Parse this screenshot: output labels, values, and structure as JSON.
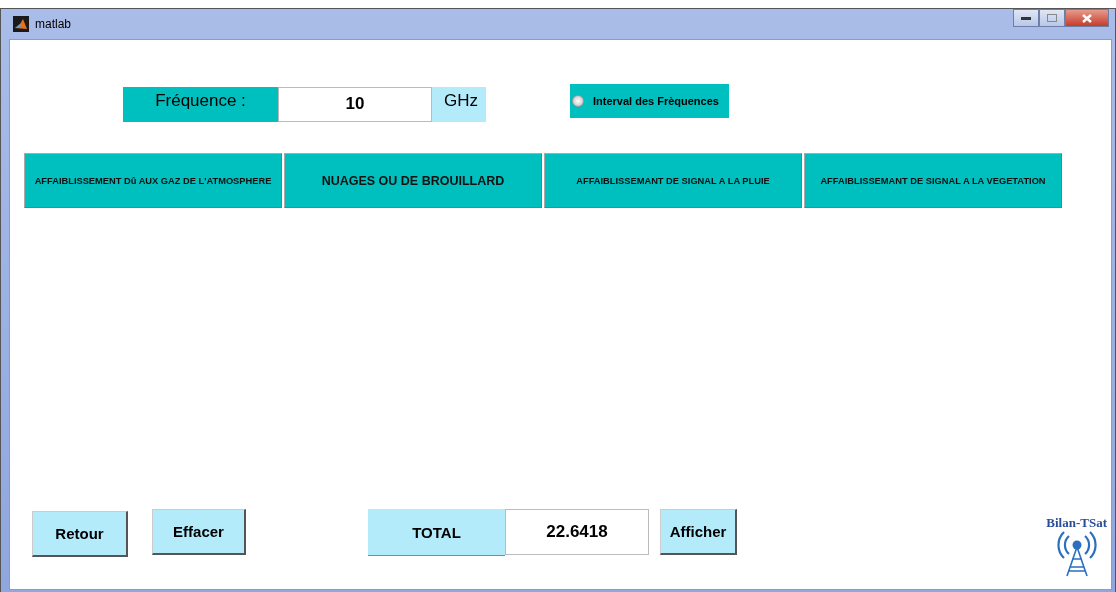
{
  "window": {
    "title": "matlab"
  },
  "frequency": {
    "label": "Fréquence :",
    "value": "10",
    "unit": "GHz"
  },
  "interval_option": {
    "label": "Interval des Frèquences",
    "checked": false
  },
  "categories": [
    {
      "label": "AFFAIBLISSEMENT Dû AUX GAZ  DE L'ATMOSPHERE",
      "kind": "small"
    },
    {
      "label": "NUAGES OU DE BROUILLARD",
      "kind": "large"
    },
    {
      "label": "AFFAIBLISSEMANT DE SIGNAL A LA PLUIE",
      "kind": "small"
    },
    {
      "label": "AFFAIBLISSEMANT DE SIGNAL A LA VEGETATION",
      "kind": "small"
    }
  ],
  "actions": [
    {
      "label": "Retour"
    },
    {
      "label": "Effacer"
    }
  ],
  "total": {
    "label": "TOTAL",
    "value": "22.6418",
    "button": "Afficher"
  },
  "logo": {
    "text": "Bilan-TSat"
  }
}
